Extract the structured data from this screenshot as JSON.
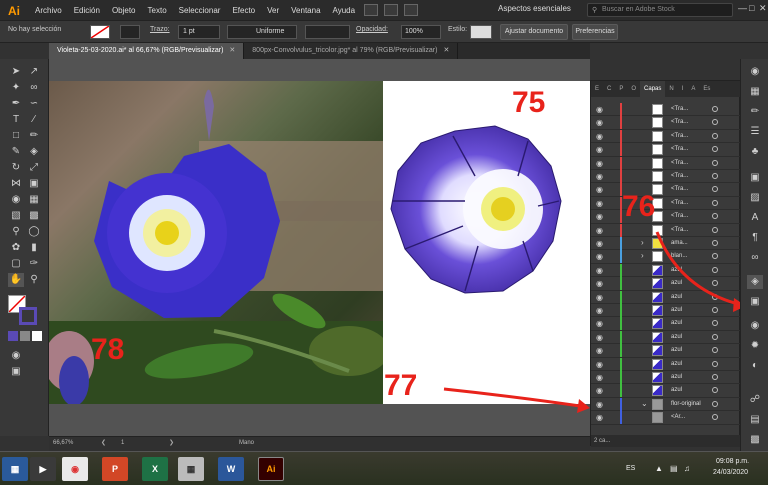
{
  "menubar": {
    "logo": "Ai",
    "items": [
      "Archivo",
      "Edición",
      "Objeto",
      "Texto",
      "Seleccionar",
      "Efecto",
      "Ver",
      "Ventana",
      "Ayuda"
    ],
    "workspace": "Aspectos esenciales",
    "search_placeholder": "Buscar en Adobe Stock"
  },
  "controlbar": {
    "selection": "No hay selección",
    "stroke_label": "Trazo:",
    "stroke_value": "1 pt",
    "profile": "Uniforme",
    "opacity_label": "Opacidad:",
    "opacity_value": "100%",
    "style_label": "Estilo:",
    "doc_button": "Ajustar documento",
    "prefs_button": "Preferencias"
  },
  "tabs": [
    {
      "label": "Violeta-25-03-2020.ai* al 66,67% (RGB/Previsualizar)"
    },
    {
      "label": "800px-Convolvulus_tricolor.jpg* al 79% (RGB/Previsualizar)"
    }
  ],
  "annotations": [
    "78",
    "75",
    "76",
    "77"
  ],
  "layers": {
    "tabs": [
      "E",
      "C",
      "P",
      "O",
      "Capas",
      "N",
      "I",
      "A",
      "Es"
    ],
    "rows": [
      {
        "name": "<Tra..."
      },
      {
        "name": "<Tra..."
      },
      {
        "name": "<Tra..."
      },
      {
        "name": "<Tra..."
      },
      {
        "name": "<Tra..."
      },
      {
        "name": "<Tra..."
      },
      {
        "name": "<Tra..."
      },
      {
        "name": "<Tra..."
      },
      {
        "name": "<Tra..."
      },
      {
        "name": "<Tra..."
      },
      {
        "name": "ama..."
      },
      {
        "name": "blan..."
      },
      {
        "name": "azul"
      },
      {
        "name": "azul"
      },
      {
        "name": "azul"
      },
      {
        "name": "azul"
      },
      {
        "name": "azul"
      },
      {
        "name": "azul"
      },
      {
        "name": "azul"
      },
      {
        "name": "azul"
      },
      {
        "name": "azul"
      },
      {
        "name": "azul"
      },
      {
        "name": "flor-original"
      },
      {
        "name": "<Ar..."
      }
    ],
    "footer": "2 ca..."
  },
  "status": {
    "zoom": "66,67%",
    "page": "1",
    "tool": "Mano"
  },
  "taskbar": {
    "lang": "ES",
    "time": "09:08 p.m.",
    "date": "24/03/2020"
  }
}
